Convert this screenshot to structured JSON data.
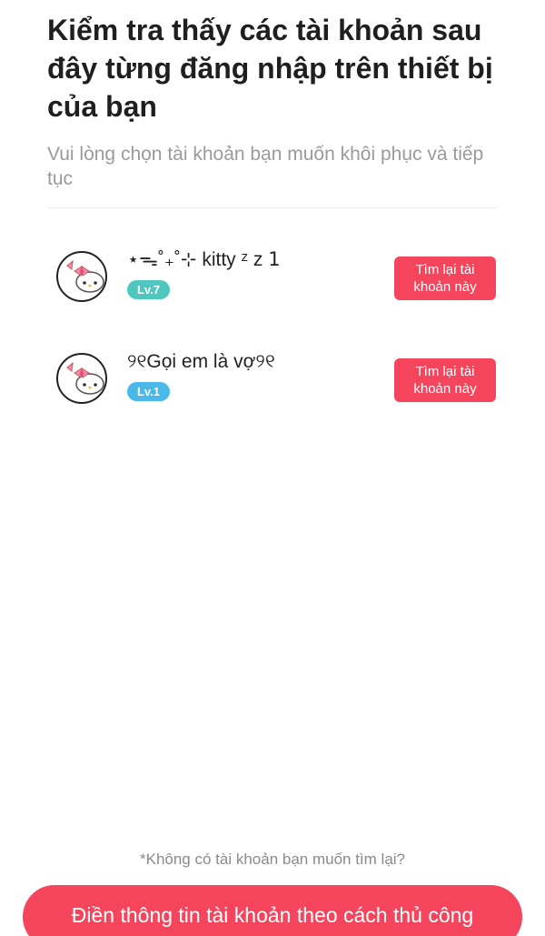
{
  "header": {
    "title": "Kiểm tra thấy các tài khoản sau đây từng đăng nhập trên thiết bị của bạn",
    "subtitle": "Vui lòng chọn tài khoản bạn muốn khôi phục và tiếp tục"
  },
  "accounts": [
    {
      "name": "⋆ᯓ˚₊˚⊹ kitty ᶻ z 𝟣",
      "level": "Lv.7",
      "level_color": "#4fc6be",
      "button_label": "Tìm lại tài khoản này",
      "avatar": "hello-kitty-avatar"
    },
    {
      "name": "୨୧Gọi  em  là  vợ୨୧",
      "level": "Lv.1",
      "level_color": "#4ab9ea",
      "button_label": "Tìm lại tài khoản này",
      "avatar": "hello-kitty-avatar"
    }
  ],
  "footer": {
    "hint": "*Không có tài khoản bạn muốn tìm lại?",
    "manual_button": "Điền thông tin tài khoản theo cách thủ công"
  },
  "colors": {
    "accent": "#f5455c",
    "secondary_text": "#9a9a9a"
  }
}
